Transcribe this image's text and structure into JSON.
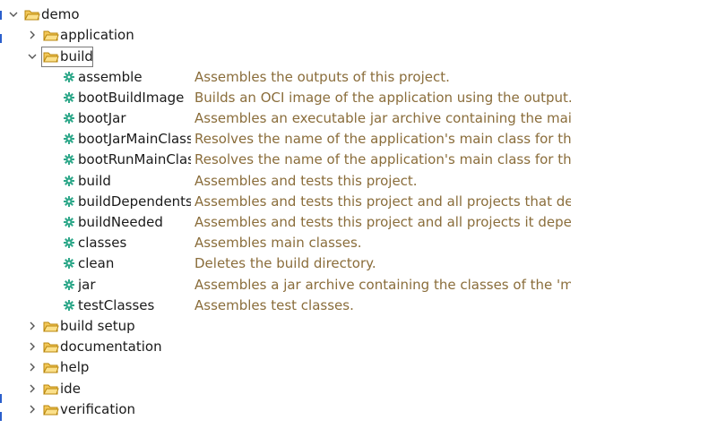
{
  "tree": {
    "root": {
      "label": "demo",
      "expanded": true
    },
    "groups_before": [
      {
        "label": "application",
        "expanded": false
      }
    ],
    "build_group": {
      "label": "build",
      "expanded": true,
      "selected": true
    },
    "tasks": [
      {
        "name": "assemble",
        "description": "Assembles the outputs of this project."
      },
      {
        "name": "bootBuildImage",
        "description": "Builds an OCI image of the application using the output..."
      },
      {
        "name": "bootJar",
        "description": "Assembles an executable jar archive containing the mai..."
      },
      {
        "name": "bootJarMainClass",
        "description": "Resolves the name of the application's main class for th..."
      },
      {
        "name": "bootRunMainClas",
        "description": "Resolves the name of the application's main class for th..."
      },
      {
        "name": "build",
        "description": "Assembles and tests this project."
      },
      {
        "name": "buildDependents",
        "description": "Assembles and tests this project and all projects that de..."
      },
      {
        "name": "buildNeeded",
        "description": "Assembles and tests this project and all projects it depe..."
      },
      {
        "name": "classes",
        "description": "Assembles main classes."
      },
      {
        "name": "clean",
        "description": "Deletes the build directory."
      },
      {
        "name": "jar",
        "description": "Assembles a jar archive containing the classes of the 'm..."
      },
      {
        "name": "testClasses",
        "description": "Assembles test classes."
      }
    ],
    "groups_after": [
      {
        "label": "build setup",
        "expanded": false
      },
      {
        "label": "documentation",
        "expanded": false
      },
      {
        "label": "help",
        "expanded": false
      },
      {
        "label": "ide",
        "expanded": false
      },
      {
        "label": "verification",
        "expanded": false
      }
    ]
  },
  "icons": {
    "collapsed": "chevron-right-icon",
    "expanded": "chevron-down-icon",
    "folder": "folder-icon",
    "task": "gear-icon"
  },
  "colors": {
    "description": "#8a6d3b",
    "task_icon": "#2fa88a",
    "folder_fill": "#f3c85a",
    "folder_stroke": "#b8860b",
    "chevron": "#555555",
    "selection_border": "#7a7a7a"
  }
}
